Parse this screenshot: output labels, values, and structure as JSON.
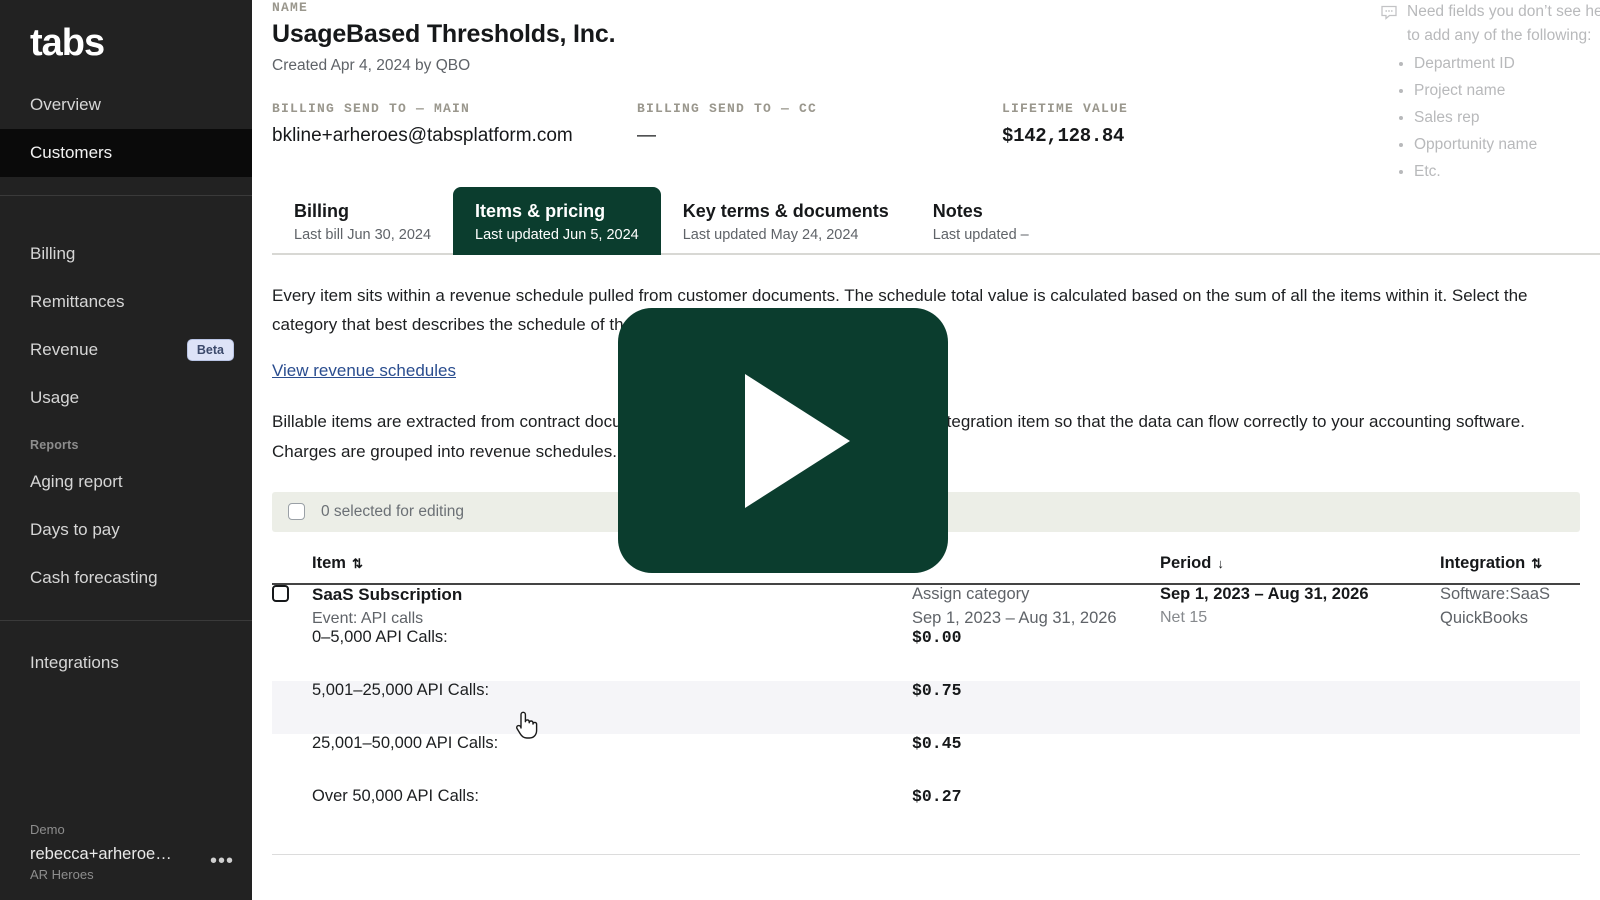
{
  "sidebar": {
    "brand": "tabs",
    "primary": [
      {
        "label": "Overview",
        "active": false
      },
      {
        "label": "Customers",
        "active": true
      }
    ],
    "secondary": [
      {
        "label": "Billing",
        "badge": ""
      },
      {
        "label": "Remittances",
        "badge": ""
      },
      {
        "label": "Revenue",
        "badge": "Beta"
      },
      {
        "label": "Usage",
        "badge": ""
      }
    ],
    "reports_label": "Reports",
    "reports": [
      {
        "label": "Aging report"
      },
      {
        "label": "Days to pay"
      },
      {
        "label": "Cash forecasting"
      }
    ],
    "integrations": {
      "label": "Integrations"
    },
    "footer": {
      "workspace_label": "Demo",
      "account_name": "rebecca+arheroe…",
      "account_org": "AR Heroes",
      "menu_glyph": "•••"
    }
  },
  "customer": {
    "name_label": "NAME",
    "name": "UsageBased Thresholds, Inc.",
    "created": "Created Apr 4, 2024 by QBO",
    "billing_main_label": "BILLING SEND TO — MAIN",
    "billing_main": "bkline+arheroes@tabsplatform.com",
    "billing_cc_label": "BILLING SEND TO — CC",
    "billing_cc": "—",
    "ltv_label": "LIFETIME VALUE",
    "ltv": "$142,128.84"
  },
  "tabs": [
    {
      "title": "Billing",
      "sub": "Last bill Jun 30, 2024",
      "active": false
    },
    {
      "title": "Items & pricing",
      "sub": "Last updated Jun 5, 2024",
      "active": true
    },
    {
      "title": "Key terms & documents",
      "sub": "Last updated May 24, 2024",
      "active": false
    },
    {
      "title": "Notes",
      "sub": "Last updated –",
      "active": false
    }
  ],
  "body": {
    "para1": "Every item sits within a revenue schedule pulled from customer documents. The schedule total value is calculated based on the sum of all the items within it. Select the category that best describes the schedule of the items within it.",
    "link": "View revenue schedules",
    "para2": "Billable items are extracted from contract documents. Each item billed must relate to an integration item so that the data can flow correctly to your accounting software. Charges are grouped into revenue schedules."
  },
  "selection": {
    "text": "0 selected for editing"
  },
  "table": {
    "columns": [
      {
        "label": "Item",
        "sort": "⇅"
      },
      {
        "label": "",
        "sort": ""
      },
      {
        "label": "Period",
        "sort": "↓"
      },
      {
        "label": "Integration",
        "sort": "⇅"
      }
    ],
    "row": {
      "name": "SaaS Subscription",
      "event": "Event: API calls",
      "category": "Assign category",
      "category_period": "Sep 1, 2023 – Aug 31, 2026",
      "period": "Sep 1, 2023 – Aug 31, 2026",
      "terms": "Net 15",
      "integration": "Software:SaaS",
      "integration_source": "QuickBooks"
    },
    "tiers": [
      {
        "label": "0–5,000 API Calls:",
        "price": "$0.00",
        "hover": false
      },
      {
        "label": "5,001–25,000 API Calls:",
        "price": "$0.75",
        "hover": true
      },
      {
        "label": "25,001–50,000 API Calls:",
        "price": "$0.45",
        "hover": false
      },
      {
        "label": "Over 50,000 API Calls:",
        "price": "$0.27",
        "hover": false
      }
    ]
  },
  "annotation": {
    "line1": "Need fields you don’t see here? Ask us",
    "line2": "to add any of the following:",
    "items": [
      "Department ID",
      "Project name",
      "Sales rep",
      "Opportunity name",
      "Etc."
    ]
  },
  "overlay": {
    "play_label": "Play video"
  },
  "colors": {
    "brand_green": "#0b3d2e",
    "sidebar_bg": "#222222",
    "sidebar_active": "#0a0a0a",
    "beta_badge_bg": "#dde3f7",
    "link": "#2a4d8f",
    "selection_bar": "#eceee7",
    "row_hover": "#f5f5f8"
  }
}
